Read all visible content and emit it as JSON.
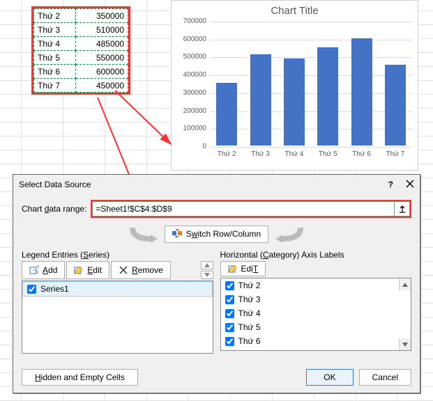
{
  "table": {
    "rows": [
      {
        "label": "Thứ 2",
        "value": "350000"
      },
      {
        "label": "Thứ 3",
        "value": "510000"
      },
      {
        "label": "Thứ 4",
        "value": "485000"
      },
      {
        "label": "Thứ 5",
        "value": "550000"
      },
      {
        "label": "Thứ 6",
        "value": "600000"
      },
      {
        "label": "Thứ 7",
        "value": "450000"
      }
    ]
  },
  "chart_data": {
    "type": "bar",
    "title": "Chart Title",
    "categories": [
      "Thứ 2",
      "Thứ 3",
      "Thứ 4",
      "Thứ 5",
      "Thứ 6",
      "Thứ 7"
    ],
    "values": [
      350000,
      510000,
      485000,
      550000,
      600000,
      450000
    ],
    "y_ticks": [
      0,
      100000,
      200000,
      300000,
      400000,
      500000,
      600000,
      700000
    ],
    "ylim": [
      0,
      700000
    ],
    "xlabel": "",
    "ylabel": ""
  },
  "dialog": {
    "title": "Select Data Source",
    "range_label_pre": "Chart ",
    "range_label_u": "d",
    "range_label_post": "ata range:",
    "range_value": "=Sheet1!$C$4:$D$9",
    "switch_pre": "S",
    "switch_u": "w",
    "switch_post": "itch Row/Column",
    "legend": {
      "header_pre": "Legend Entries (",
      "header_u": "S",
      "header_post": "eries)",
      "add_u": "A",
      "add_post": "dd",
      "edit_u": "E",
      "edit_post": "dit",
      "remove_u": "R",
      "remove_post": "emove",
      "items": [
        {
          "label": "Series1",
          "checked": true
        }
      ]
    },
    "category": {
      "header_pre": "Horizontal (",
      "header_u": "C",
      "header_post": "ategory) Axis Labels",
      "edit_u": "T",
      "edit_pre": "Edi",
      "items": [
        {
          "label": "Thứ 2",
          "checked": true
        },
        {
          "label": "Thứ 3",
          "checked": true
        },
        {
          "label": "Thứ 4",
          "checked": true
        },
        {
          "label": "Thứ 5",
          "checked": true
        },
        {
          "label": "Thứ 6",
          "checked": true
        }
      ]
    },
    "hidden_btn_u": "H",
    "hidden_btn_post": "idden and Empty Cells",
    "ok": "OK",
    "cancel": "Cancel"
  }
}
